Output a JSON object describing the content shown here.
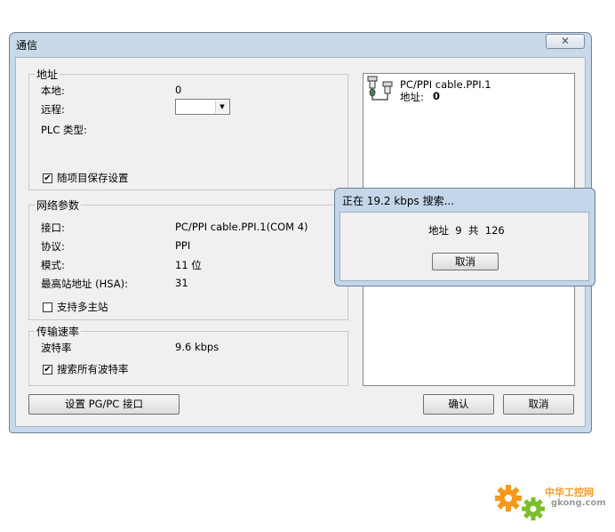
{
  "window": {
    "title": "通信",
    "close_glyph": "✕"
  },
  "address_group": {
    "legend": "地址",
    "local_label": "本地:",
    "local_value": "0",
    "remote_label": "远程:",
    "plc_type_label": "PLC 类型:",
    "save_with_project_label": "随项目保存设置",
    "save_with_project_checked": true
  },
  "network_group": {
    "legend": "网络参数",
    "interface_label": "接口:",
    "interface_value": "PC/PPI cable.PPI.1(COM 4)",
    "protocol_label": "协议:",
    "protocol_value": "PPI",
    "mode_label": "模式:",
    "mode_value": "11 位",
    "hsa_label": "最高站地址 (HSA):",
    "hsa_value": "31",
    "multi_master_label": "支持多主站",
    "multi_master_checked": false
  },
  "baud_group": {
    "legend": "传输速率",
    "baud_label": "波特率",
    "baud_value": "9.6 kbps",
    "search_all_label": "搜索所有波特率",
    "search_all_checked": true
  },
  "device_tree": {
    "cable_name": "PC/PPI cable.PPI.1",
    "address_label": "地址:",
    "address_value": "0"
  },
  "buttons": {
    "set_pgpc": "设置 PG/PC 接口",
    "ok": "确认",
    "cancel": "取消"
  },
  "progress_popup": {
    "title": "正在 19.2 kbps 搜索...",
    "status": "地址  9  共  126",
    "cancel": "取消"
  },
  "watermark": {
    "line1": "中华工控网",
    "line2": "gkong.com"
  },
  "colors": {
    "frame": "#c9d9ea",
    "client": "#f0f0f0",
    "watermark_orange": "#f39a1e",
    "watermark_green": "#7cbf2a"
  }
}
